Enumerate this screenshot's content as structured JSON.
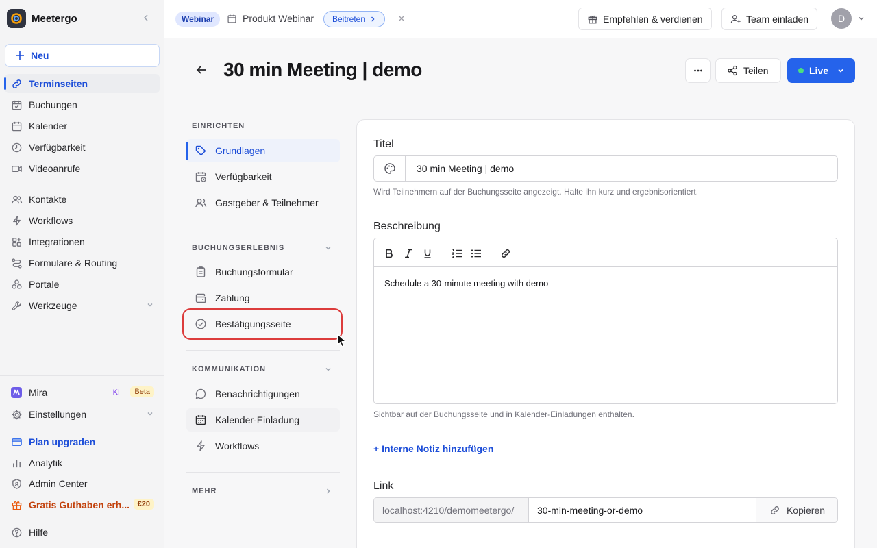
{
  "brand": {
    "name": "Meetergo"
  },
  "sidebar": {
    "new_label": "Neu",
    "items": [
      {
        "label": "Terminseiten"
      },
      {
        "label": "Buchungen"
      },
      {
        "label": "Kalender"
      },
      {
        "label": "Verfügbarkeit"
      },
      {
        "label": "Videoanrufe"
      },
      {
        "label": "Kontakte"
      },
      {
        "label": "Workflows"
      },
      {
        "label": "Integrationen"
      },
      {
        "label": "Formulare & Routing"
      },
      {
        "label": "Portale"
      },
      {
        "label": "Werkzeuge"
      }
    ],
    "bottom": {
      "mira": "Mira",
      "ki_badge": "KI",
      "beta_badge": "Beta",
      "settings": "Einstellungen",
      "upgrade": "Plan upgraden",
      "analytics": "Analytik",
      "admin": "Admin Center",
      "credit": "Gratis Guthaben erh...",
      "credit_badge": "€20",
      "help": "Hilfe"
    }
  },
  "topbar": {
    "webinar_pill": "Webinar",
    "webinar_name": "Produkt Webinar",
    "join_label": "Beitreten",
    "refer_label": "Empfehlen & verdienen",
    "invite_label": "Team einladen",
    "avatar_initial": "D"
  },
  "header": {
    "title": "30 min Meeting | demo",
    "share_label": "Teilen",
    "live_label": "Live"
  },
  "settings_nav": {
    "sections": [
      {
        "label": "EINRICHTEN",
        "items": [
          "Grundlagen",
          "Verfügbarkeit",
          "Gastgeber & Teilnehmer"
        ]
      },
      {
        "label": "BUCHUNGSERLEBNIS",
        "items": [
          "Buchungsformular",
          "Zahlung",
          "Bestätigungsseite"
        ]
      },
      {
        "label": "KOMMUNIKATION",
        "items": [
          "Benachrichtigungen",
          "Kalender-Einladung",
          "Workflows"
        ]
      },
      {
        "label": "MEHR",
        "items": []
      }
    ]
  },
  "form": {
    "title_label": "Titel",
    "title_value": "30 min Meeting | demo",
    "title_hint": "Wird Teilnehmern auf der Buchungsseite angezeigt. Halte ihn kurz und ergebnisorientiert.",
    "description_label": "Beschreibung",
    "description_value": "Schedule a 30-minute meeting with demo",
    "description_hint": "Sichtbar auf der Buchungsseite und in Kalender-Einladungen enthalten.",
    "internal_note_link": "+ Interne Notiz hinzufügen",
    "link_label": "Link",
    "link_prefix": "localhost:4210/demomeetergo/",
    "link_slug": "30-min-meeting-or-demo",
    "copy_label": "Kopieren"
  },
  "colors": {
    "accent": "#2563eb",
    "live_dot": "#4ade80",
    "highlight": "#dc3c3c"
  }
}
